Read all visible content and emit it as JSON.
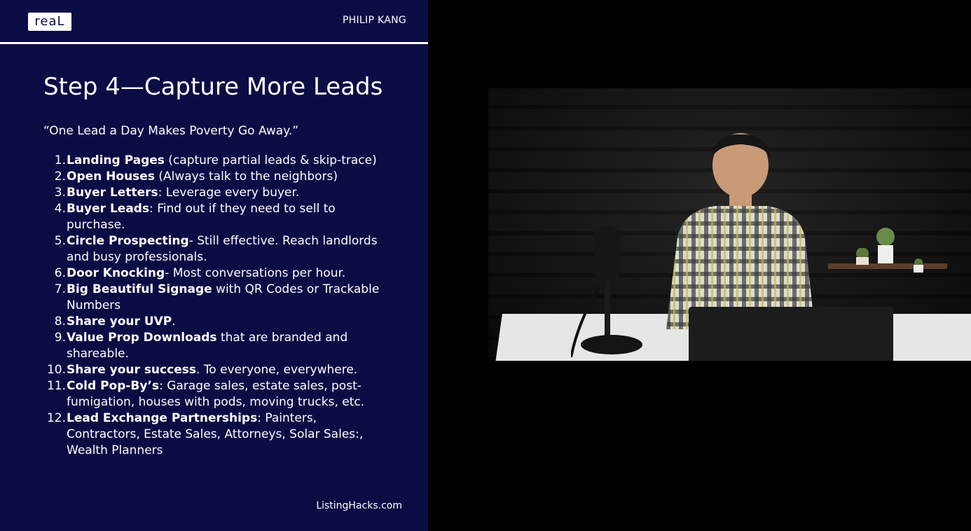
{
  "slide": {
    "logo_text": "reaL",
    "presenter": "PHILIP KANG",
    "title": "Step 4—Capture More Leads",
    "quote": "“One Lead a Day Makes Poverty Go Away.”",
    "items": [
      {
        "num": "1.",
        "bold": "Landing Pages",
        "text": " (capture partial leads & skip-trace)"
      },
      {
        "num": "2.",
        "bold": "Open Houses",
        "text": " (Always talk to the neighbors)"
      },
      {
        "num": "3.",
        "bold": "Buyer Letters",
        "text": ": Leverage every buyer."
      },
      {
        "num": "4.",
        "bold": "Buyer Leads",
        "text": ": Find out if they need to sell to purchase."
      },
      {
        "num": "5.",
        "bold": "Circle Prospecting",
        "text": "- Still effective. Reach landlords and busy professionals."
      },
      {
        "num": "6.",
        "bold": "Door Knocking",
        "text": "- Most conversations per hour."
      },
      {
        "num": "7.",
        "bold": "Big Beautiful Signage",
        "text": " with QR Codes or Trackable Numbers"
      },
      {
        "num": "8.",
        "bold": "Share your UVP",
        "text": "."
      },
      {
        "num": "9.",
        "bold": "Value Prop Downloads",
        "text": " that are branded and shareable."
      },
      {
        "num": "10.",
        "bold": "Share your success",
        "text": ". To everyone, everywhere."
      },
      {
        "num": "11.",
        "bold": "Cold Pop-By’s",
        "text": ": Garage sales, estate sales, post-fumigation, houses with pods, moving trucks, etc."
      },
      {
        "num": "12.",
        "bold": "Lead Exchange Partnerships",
        "text": ":  Painters, Contractors, Estate Sales, Attorneys, Solar Sales:, Wealth Planners"
      }
    ],
    "site": "ListingHacks.com"
  },
  "colors": {
    "slide_bg": "#0c0c45",
    "text": "#ffffff",
    "page_bg": "#000000"
  }
}
